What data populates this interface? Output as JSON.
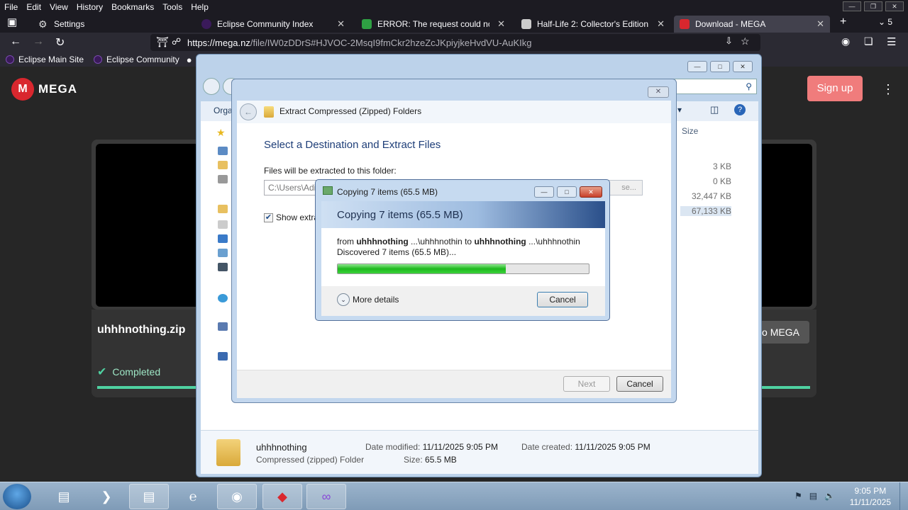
{
  "firefox": {
    "menu": [
      "File",
      "Edit",
      "View",
      "History",
      "Bookmarks",
      "Tools",
      "Help"
    ],
    "tabs": [
      {
        "label": "Settings",
        "icon": "gear-icon",
        "color": "#42414d"
      },
      {
        "label": "Eclipse Community Index",
        "icon": "eclipse-icon",
        "color": "#3a1a5a"
      },
      {
        "label": "ERROR: The request could not b",
        "icon": "error-icon",
        "color": "#2ea043"
      },
      {
        "label": "Half-Life 2: Collector's Edition : '",
        "icon": "archive-icon",
        "color": "#cccccc"
      },
      {
        "label": "Download - MEGA",
        "icon": "mega-icon",
        "color": "#d9272e"
      }
    ],
    "tab_count": "5",
    "url_domain": "https://mega.nz",
    "url_rest": "/file/IW0zDDrS#HJVOC-2MsqI9fmCkr2hzeZcJKpiyjkeHvdVU-AuKIkg",
    "bookmarks": [
      "Eclipse Main Site",
      "Eclipse Community"
    ]
  },
  "mega": {
    "logo_letter": "M",
    "logo_text": "MEGA",
    "signup": "Sign up",
    "file_name": "uhhhnothing.zip",
    "status": "Completed",
    "partial_button": "o MEGA",
    "accent": "#d9272e",
    "success_color": "#4fd1a1"
  },
  "explorer": {
    "toolbar_org": "Orga",
    "size_header": "Size",
    "sizes": [
      "3 KB",
      "0 KB",
      "32,447 KB",
      "67,133 KB"
    ],
    "details": {
      "name": "uhhhnothing",
      "type": "Compressed (zipped) Folder",
      "modified_label": "Date modified:",
      "modified": "11/11/2025 9:05 PM",
      "created_label": "Date created:",
      "created": "11/11/2025 9:05 PM",
      "size_label": "Size:",
      "size": "65.5 MB"
    }
  },
  "extract": {
    "window_title": "Extract Compressed (Zipped) Folders",
    "heading": "Select a Destination and Extract Files",
    "folder_label": "Files will be extracted to this folder:",
    "path_value": "C:\\Users\\Adi",
    "browse": "se...",
    "show_label": "Show extra",
    "next": "Next",
    "cancel": "Cancel"
  },
  "copy": {
    "window_title": "Copying 7 items (65.5 MB)",
    "banner": "Copying 7 items (65.5 MB)",
    "from_word": "from",
    "src_bold": "uhhhnothing",
    "src_path": "...\\uhhhnothin",
    "to_word": "to",
    "dst_bold": "uhhhnothing",
    "dst_path": "...\\uhhhnothin",
    "discovered": "Discovered 7 items (65.5 MB)...",
    "progress": 0.67,
    "more_details": "More details",
    "cancel": "Cancel"
  },
  "taskbar": {
    "time": "9:05 PM",
    "date": "11/11/2025"
  }
}
